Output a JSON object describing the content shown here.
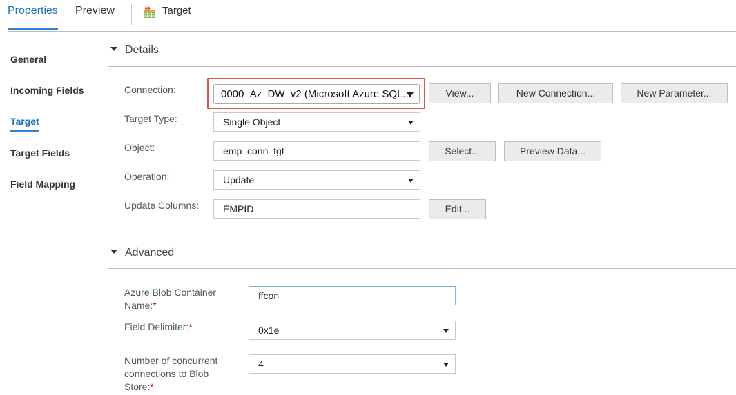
{
  "top_tabs": {
    "properties": "Properties",
    "preview": "Preview",
    "target": "Target"
  },
  "nav": {
    "items": [
      {
        "label": "General"
      },
      {
        "label": "Incoming Fields"
      },
      {
        "label": "Target"
      },
      {
        "label": "Target Fields"
      },
      {
        "label": "Field Mapping"
      }
    ],
    "active": "Target"
  },
  "details": {
    "title": "Details",
    "connection": {
      "label": "Connection:",
      "value": "0000_Az_DW_v2 (Microsoft Azure SQL...",
      "view_button": "View...",
      "new_connection_button": "New Connection...",
      "new_parameter_button": "New Parameter..."
    },
    "target_type": {
      "label": "Target Type:",
      "value": "Single Object"
    },
    "object": {
      "label": "Object:",
      "value": "emp_conn_tgt",
      "select_button": "Select...",
      "preview_button": "Preview Data..."
    },
    "operation": {
      "label": "Operation:",
      "value": "Update"
    },
    "update_columns": {
      "label": "Update Columns:",
      "value": "EMPID",
      "edit_button": "Edit..."
    }
  },
  "advanced": {
    "title": "Advanced",
    "container_name": {
      "label_line1": "Azure Blob Container",
      "label_line2": "Name:",
      "required_mark": "*",
      "value": "ffcon"
    },
    "field_delimiter": {
      "label": "Field Delimiter:",
      "required_mark": "*",
      "value": "0x1e"
    },
    "concurrent_connections": {
      "label_line1": "Number of concurrent",
      "label_line2": "connections to Blob",
      "label_line3": "Store:",
      "required_mark": "*",
      "value": "4"
    }
  },
  "colors": {
    "accent": "#2f7ed8",
    "active_text": "#1a6fc4",
    "highlight_border": "#d9534f",
    "required": "#d0021b",
    "button_bg": "#ebebeb"
  },
  "icons": {
    "target": "table-target-icon",
    "section_caret": "caret-down-icon",
    "dropdown": "dropdown-arrow-icon"
  }
}
